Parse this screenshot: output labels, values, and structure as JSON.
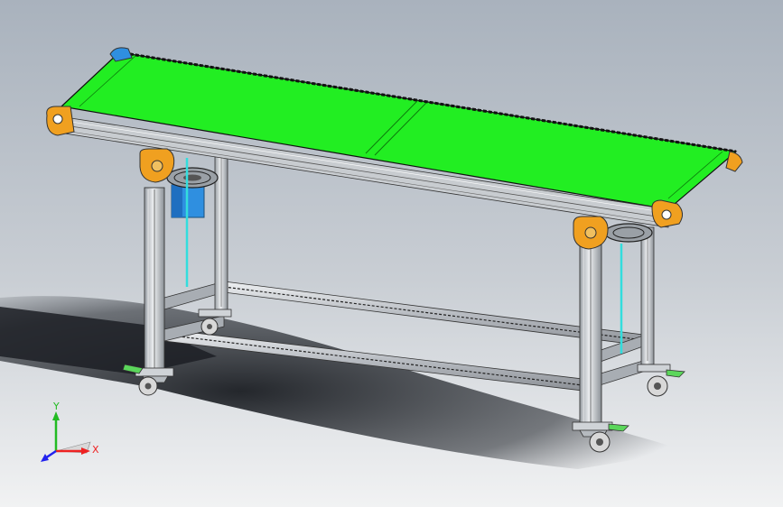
{
  "viewport": {
    "background_top": "#a9b2bd",
    "background_bottom": "#f1f2f3"
  },
  "model": {
    "belt_color": "#22ee22",
    "frame_color": "#c8ccd0",
    "end_cap_color": "#f0a020",
    "motor_color": "#2f8fe0",
    "guide_color": "#33dddd",
    "wheel_color": "#d8d8d8"
  },
  "triad": {
    "x_label": "X",
    "y_label": "Y",
    "x_color": "#ee2222",
    "y_color": "#22bb22",
    "z_color": "#2222ee"
  }
}
